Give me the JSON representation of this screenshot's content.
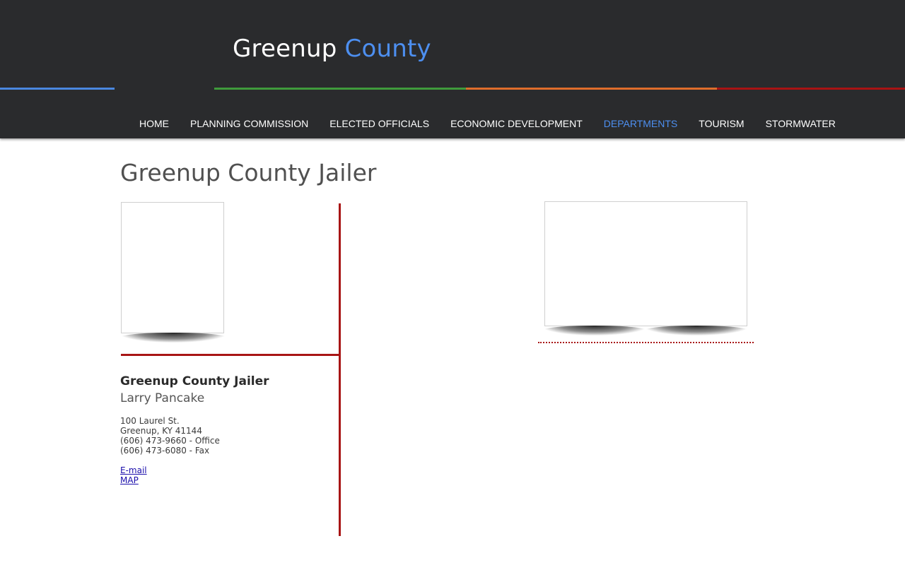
{
  "site": {
    "title_main": "Greenup",
    "title_accent": "County"
  },
  "nav": {
    "items": [
      "HOME",
      "PLANNING COMMISSION",
      "ELECTED OFFICIALS",
      "ECONOMIC DEVELOPMENT",
      "DEPARTMENTS",
      "TOURISM",
      "STORMWATER"
    ],
    "active": "DEPARTMENTS"
  },
  "colors": {
    "header_bg": "#2a2b2d",
    "accent_blue": "#4d8ff0",
    "stripe_blue": "#4a88e0",
    "stripe_green": "#3f9b3c",
    "stripe_orange": "#df6d2b",
    "stripe_red": "#a91313",
    "divider_red": "#a81515"
  },
  "page": {
    "title": "Greenup County Jailer"
  },
  "official": {
    "title": "Greenup County Jailer",
    "name": "Larry Pancake",
    "address_line1": "100 Laurel St.",
    "address_line2": "Greenup, KY 41144",
    "phone_office": "(606) 473-9660 - Office",
    "phone_fax": "(606) 473-6080 - Fax",
    "email_link": "E-mail",
    "map_link": "MAP"
  }
}
